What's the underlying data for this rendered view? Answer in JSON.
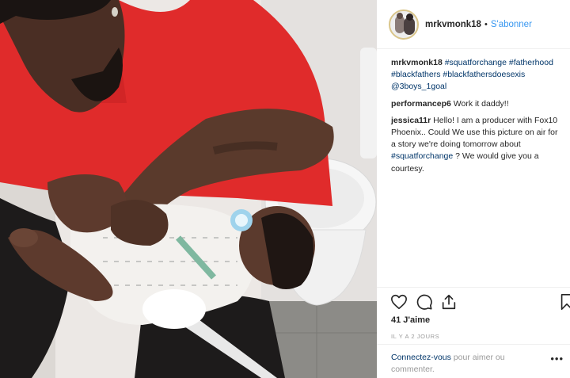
{
  "post": {
    "username": "mrkvmonk18",
    "separator": "•",
    "follow_label": "S'abonner",
    "caption": {
      "username": "mrkvmonk18",
      "hashtags": [
        "#squatforchange",
        "#fatherhood",
        "#blackfathers",
        "#blackfathersdoesexis"
      ],
      "mention": "@3boys_1goal"
    },
    "comments": [
      {
        "username": "performancep6",
        "text": "Work it daddy!!"
      },
      {
        "username": "jessica11r",
        "text_before": "Hello! I am a producer with Fox10 Phoenix.. Could We use this picture on air for a story we're doing tomorrow about",
        "hashtag": "#squatforchange",
        "text_after": "? We would give you a courtesy."
      }
    ],
    "likes": "41 J'aime",
    "timestamp": "IL Y A 2 JOURS",
    "login_prompt": {
      "link": "Connectez-vous",
      "text": "pour aimer ou commenter."
    },
    "more_label": "•••"
  },
  "icons": {
    "avatar": "profile-avatar",
    "like": "heart-icon",
    "comment": "comment-icon",
    "share": "share-icon",
    "save": "bookmark-icon"
  },
  "colors": {
    "link": "#3897f0",
    "hashtag": "#003569",
    "muted": "#999999",
    "text": "#262626",
    "shirt": "#e02b2b"
  }
}
